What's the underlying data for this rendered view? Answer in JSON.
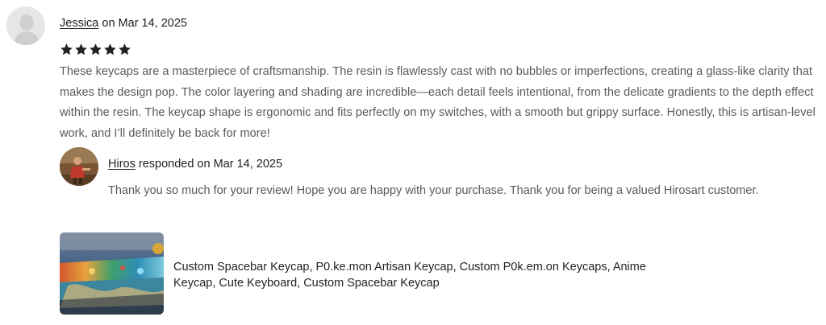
{
  "review": {
    "reviewer_name": "Jessica",
    "date_text": " on Mar 14, 2025",
    "rating": 5,
    "text": "These keycaps are a masterpiece of craftsmanship. The resin is flawlessly cast with no bubbles or imperfections, creating a glass-like clarity that makes the design pop. The color layering and shading are incredible—each detail feels intentional, from the delicate gradients to the depth effect within the resin. The keycap shape is ergonomic and fits perfectly on my switches, with a smooth but grippy surface. Honestly, this is artisan-level work, and I’ll definitely be back for more!"
  },
  "response": {
    "seller_name": "Hiros",
    "date_text": " responded on Mar 14, 2025",
    "text": "Thank you so much for your review! Hope you are happy with your purchase. Thank you for being a valued Hirosart customer."
  },
  "product": {
    "title": "Custom Spacebar Keycap, P0.ke.mon Artisan Keycap, Custom P0k.em.on Keycaps, Anime Keycap, Cute Keyboard, Custom Spacebar Keycap"
  },
  "icons": {
    "reviewer_avatar": "default-user-avatar-icon",
    "star": "star-icon"
  },
  "colors": {
    "star": "#222222",
    "body_text": "#595959",
    "name_text": "#222222"
  }
}
